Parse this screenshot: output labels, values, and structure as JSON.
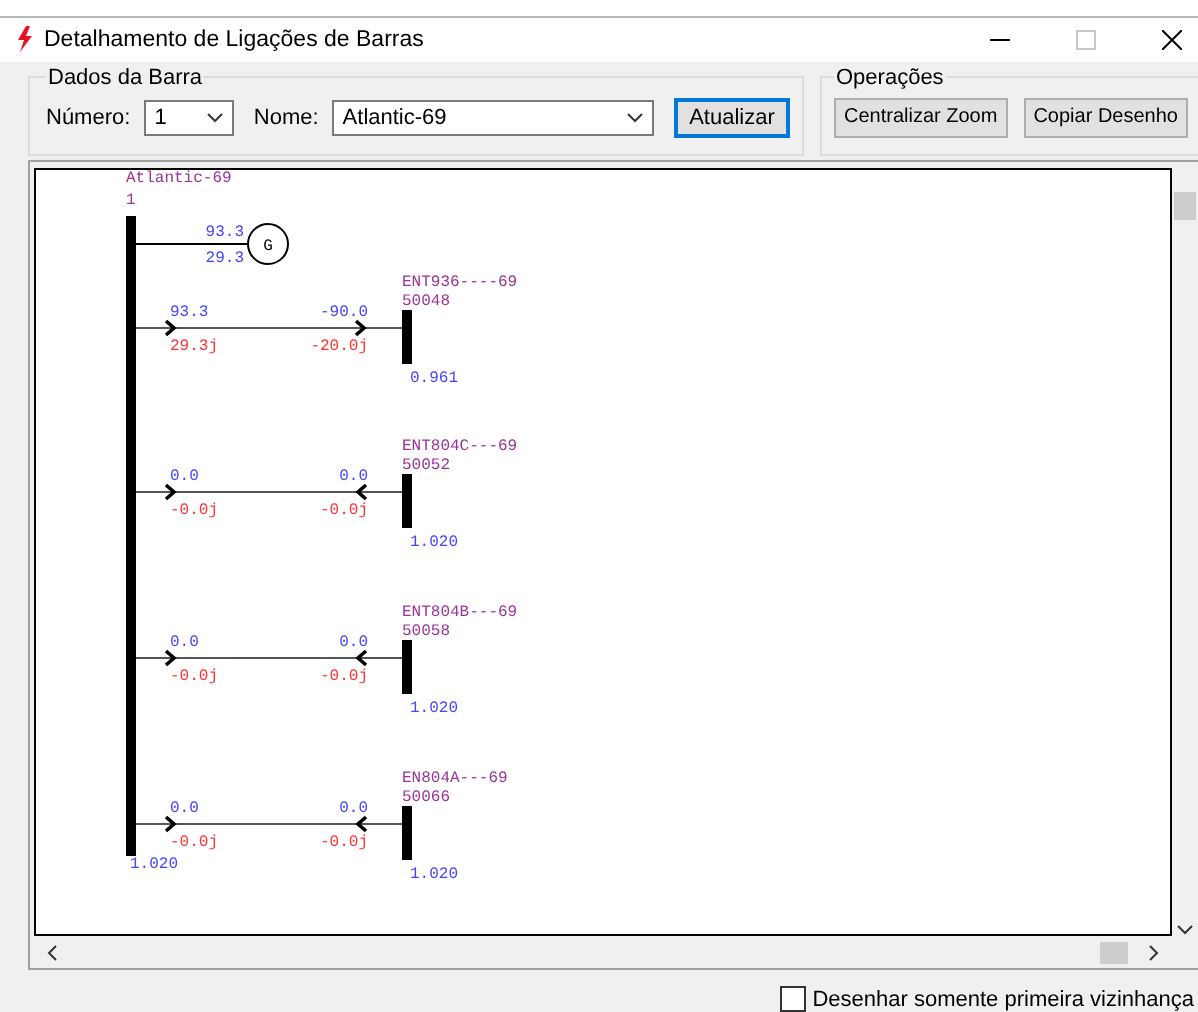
{
  "window": {
    "title": "Detalhamento de Ligações de Barras"
  },
  "bus_data": {
    "title": "Dados da Barra",
    "number_label": "Número:",
    "number_value": "1",
    "name_label": "Nome:",
    "name_value": "Atlantic-69",
    "update_button": "Atualizar"
  },
  "operations": {
    "title": "Operações",
    "buttons": [
      "Centralizar Zoom",
      "Copiar Desenho"
    ]
  },
  "diagram": {
    "main_bus": {
      "name": "Atlantic-69",
      "number": "1",
      "voltage": "1.020"
    },
    "generator": {
      "symbol": "G",
      "p": "93.3",
      "q": "29.3"
    },
    "branches": [
      {
        "to_name": "ENT936----69",
        "to_number": "50048",
        "to_voltage": "0.961",
        "p_from": "93.3",
        "q_from": "29.3j",
        "p_to": "-90.0",
        "q_to": "-20.0j",
        "to_arrow_points_to_bus": true
      },
      {
        "to_name": "ENT804C---69",
        "to_number": "50052",
        "to_voltage": "1.020",
        "p_from": "0.0",
        "q_from": "-0.0j",
        "p_to": "0.0",
        "q_to": "-0.0j",
        "to_arrow_points_to_bus": false
      },
      {
        "to_name": "ENT804B---69",
        "to_number": "50058",
        "to_voltage": "1.020",
        "p_from": "0.0",
        "q_from": "-0.0j",
        "p_to": "0.0",
        "q_to": "-0.0j",
        "to_arrow_points_to_bus": false
      },
      {
        "to_name": "EN804A---69",
        "to_number": "50066",
        "to_voltage": "1.020",
        "p_from": "0.0",
        "q_from": "-0.0j",
        "p_to": "0.0",
        "q_to": "-0.0j",
        "to_arrow_points_to_bus": false
      }
    ]
  },
  "first_neighborhood_checkbox": {
    "label": "Desenhar somente primeira vizinhança",
    "checked": false
  }
}
